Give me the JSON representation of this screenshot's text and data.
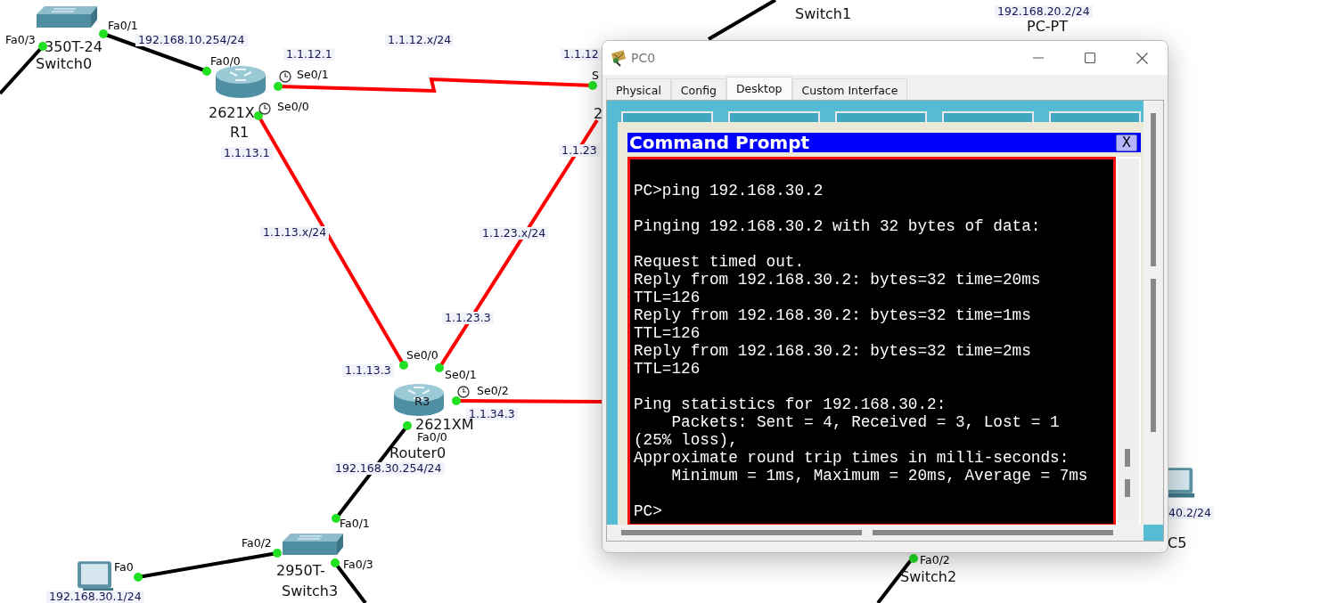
{
  "topology": {
    "labels": [
      {
        "text": "Fa0/1",
        "kind": "port"
      },
      {
        "text": "Fa0/3",
        "kind": "port"
      },
      {
        "text": "350T-24",
        "kind": "device"
      },
      {
        "text": "Switch0",
        "kind": "device"
      },
      {
        "text": "192.168.10.254/24",
        "kind": "address"
      },
      {
        "text": "Fa0/0",
        "kind": "port"
      },
      {
        "text": "1.1.12.1",
        "kind": "address"
      },
      {
        "text": "Se0/1",
        "kind": "port"
      },
      {
        "text": "Se0/0",
        "kind": "port"
      },
      {
        "text": "2621X",
        "kind": "device"
      },
      {
        "text": "R1",
        "kind": "device"
      },
      {
        "text": "1.1.13.1",
        "kind": "address"
      },
      {
        "text": "1.1.12.x/24",
        "kind": "address"
      },
      {
        "text": "1.1.12",
        "kind": "address"
      },
      {
        "text": "S",
        "kind": "port"
      },
      {
        "text": "2",
        "kind": "device"
      },
      {
        "text": "1.1.23",
        "kind": "address"
      },
      {
        "text": "1.1.13.x/24",
        "kind": "address"
      },
      {
        "text": "1.1.23.x/24",
        "kind": "address"
      },
      {
        "text": "1.1.23.3",
        "kind": "address"
      },
      {
        "text": "Se0/0",
        "kind": "port"
      },
      {
        "text": "1.1.13.3",
        "kind": "address"
      },
      {
        "text": "Se0/1",
        "kind": "port"
      },
      {
        "text": "Se0/2",
        "kind": "port"
      },
      {
        "text": "R3",
        "kind": "tag"
      },
      {
        "text": "1.1.34.3",
        "kind": "address"
      },
      {
        "text": "2621XM",
        "kind": "device"
      },
      {
        "text": "Fa0/0",
        "kind": "port"
      },
      {
        "text": "Router0",
        "kind": "device"
      },
      {
        "text": "192.168.30.254/24",
        "kind": "address"
      },
      {
        "text": "Fa0/1",
        "kind": "port"
      },
      {
        "text": "Fa0/2",
        "kind": "port"
      },
      {
        "text": "Fa0/3",
        "kind": "port"
      },
      {
        "text": "2950T-",
        "kind": "device"
      },
      {
        "text": "Switch3",
        "kind": "device"
      },
      {
        "text": "Fa0",
        "kind": "port"
      },
      {
        "text": "192.168.30.1/24",
        "kind": "address"
      },
      {
        "text": "Switch1",
        "kind": "device"
      },
      {
        "text": "192.168.20.2/24",
        "kind": "address"
      },
      {
        "text": "PC-PT",
        "kind": "device"
      },
      {
        "text": "40.2/24",
        "kind": "address"
      },
      {
        "text": "C5",
        "kind": "device"
      },
      {
        "text": "Switch2",
        "kind": "device"
      },
      {
        "text": "Fa0/2",
        "kind": "port"
      }
    ]
  },
  "window": {
    "title": "PC0",
    "tabs": [
      {
        "label": "Physical",
        "selected": false
      },
      {
        "label": "Config",
        "selected": false
      },
      {
        "label": "Desktop",
        "selected": true
      },
      {
        "label": "Custom Interface",
        "selected": false
      }
    ],
    "command_prompt": {
      "title": "Command Prompt",
      "close": "X",
      "blocks": [
        [
          "PC>ping 192.168.30.2"
        ],
        [
          "Pinging 192.168.30.2 with 32 bytes of data:"
        ],
        [
          "Request timed out.",
          "Reply from 192.168.30.2: bytes=32 time=20ms",
          "TTL=126",
          "Reply from 192.168.30.2: bytes=32 time=1ms",
          "TTL=126",
          "Reply from 192.168.30.2: bytes=32 time=2ms",
          "TTL=126"
        ],
        [
          "Ping statistics for 192.168.30.2:",
          "    Packets: Sent = 4, Received = 3, Lost = 1",
          "(25% loss),",
          "Approximate round trip times in milli-seconds:",
          "    Minimum = 1ms, Maximum = 20ms, Average = 7ms"
        ],
        [
          "PC>"
        ]
      ]
    }
  }
}
